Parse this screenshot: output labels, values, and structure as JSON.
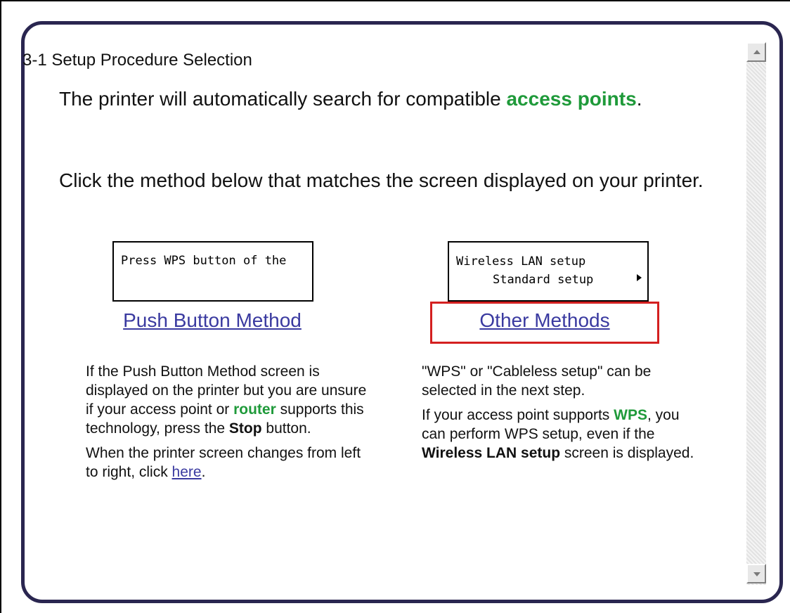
{
  "section_title": "3-1 Setup Procedure Selection",
  "intro": {
    "line1_text": "The printer will automatically search for compatible ",
    "line1_highlight": "access points",
    "line1_end": ".",
    "line2": "Click the method below that matches the screen displayed on your printer."
  },
  "left_option": {
    "screen_text": "Press WPS button of the",
    "link_label": "Push Button Method",
    "desc_p1_a": "If the Push Button Method screen is displayed on the printer but you are unsure if your access point or ",
    "desc_p1_highlight": "router",
    "desc_p1_b": " supports this technology, press the ",
    "desc_p1_bold": "Stop",
    "desc_p1_c": " button.",
    "desc_p2_a": "When the printer screen changes from left to right, click ",
    "desc_p2_link": "here",
    "desc_p2_b": "."
  },
  "right_option": {
    "screen_line1": "Wireless LAN setup",
    "screen_line2": "Standard setup",
    "link_label": "Other Methods",
    "desc_p1": "\"WPS\" or \"Cableless setup\" can be selected in the next step.",
    "desc_p2_a": "If your access point supports ",
    "desc_p2_highlight": "WPS",
    "desc_p2_b": ", you can perform WPS setup, even if the ",
    "desc_p2_bold": "Wireless LAN setup",
    "desc_p2_c": " screen is displayed."
  },
  "colors": {
    "highlight_green": "#1f9a3a",
    "link_blue": "#3a3aa0",
    "selection_red": "#d42020",
    "panel_border": "#2a2650"
  },
  "icons": {
    "scroll_up": "scroll-up-arrow-icon",
    "scroll_down": "scroll-down-arrow-icon",
    "menu_arrow": "right-triangle-icon"
  }
}
